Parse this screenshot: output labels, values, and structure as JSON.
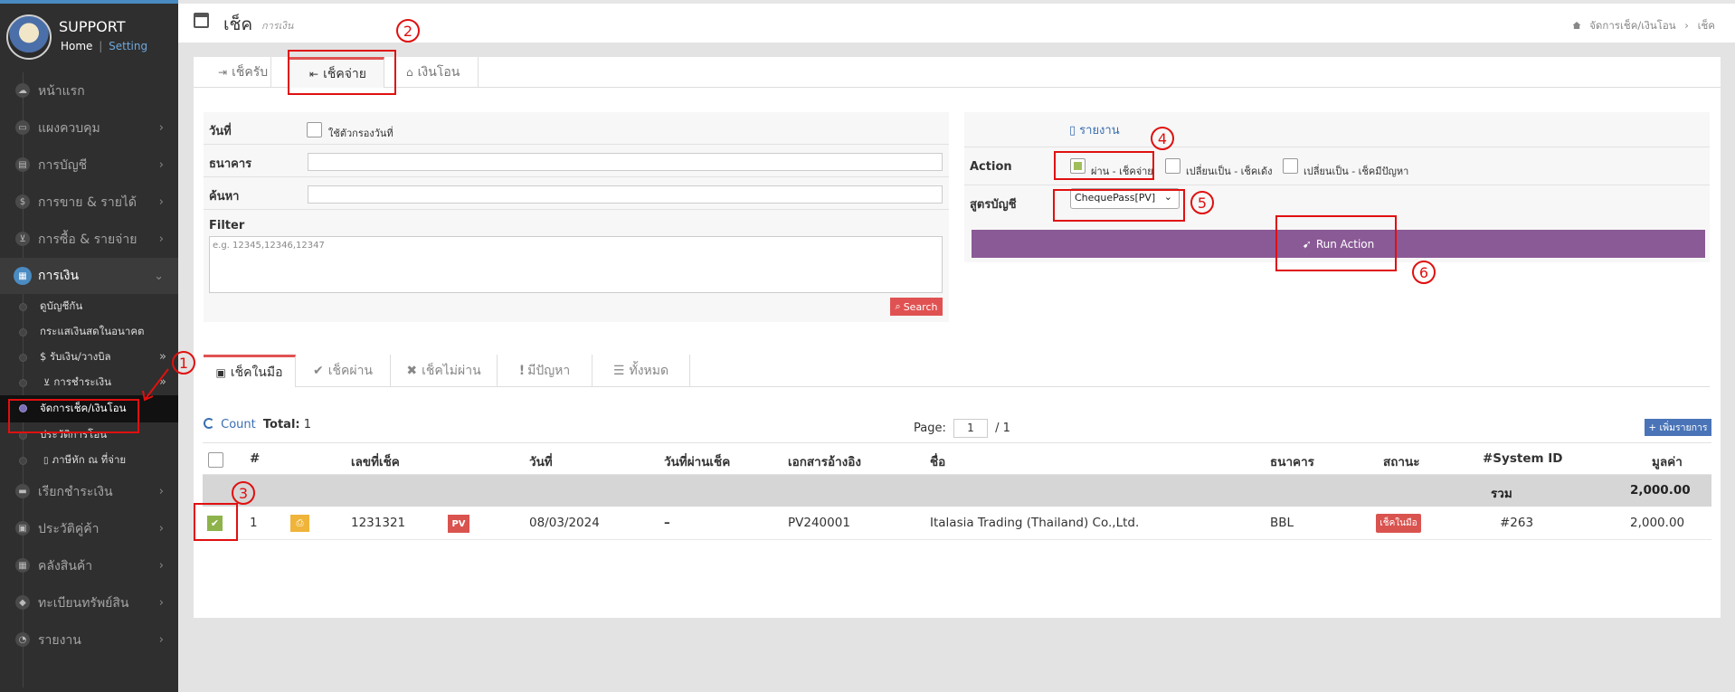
{
  "brand": {
    "title": "SUPPORT",
    "home": "Home",
    "separator": "|",
    "setting": "Setting"
  },
  "sidebar": {
    "items": [
      {
        "label": "หน้าแรก",
        "icon": "cloud-icon"
      },
      {
        "label": "แผงควบคุม",
        "icon": "monitor-icon"
      },
      {
        "label": "การบัญชี",
        "icon": "book-icon"
      },
      {
        "label": "การขาย & รายได้",
        "icon": "dollar-icon"
      },
      {
        "label": "การซื้อ & รายจ่าย",
        "icon": "cart-icon"
      },
      {
        "label": "การเงิน",
        "icon": "calendar-icon"
      }
    ],
    "sub_items": [
      {
        "label": "ดูบัญชีกัน"
      },
      {
        "label": "กระแสเงินสดในอนาคต"
      },
      {
        "label": "$ รับเงิน/วางบิล"
      },
      {
        "label": "การชำระเงิน"
      },
      {
        "label": "จัดการเช็ค/เงินโอน"
      },
      {
        "label": "ประวัติการโอน"
      },
      {
        "label": "ภาษีหัก ณ ที่จ่าย"
      }
    ],
    "items_after": [
      {
        "label": "เรียกชำระเงิน",
        "icon": "card-icon"
      },
      {
        "label": "ประวัติคู่ค้า",
        "icon": "contact-icon"
      },
      {
        "label": "คลังสินค้า",
        "icon": "boxes-icon"
      },
      {
        "label": "ทะเบียนทรัพย์สิน",
        "icon": "diamond-icon"
      },
      {
        "label": "รายงาน",
        "icon": "report-icon"
      }
    ]
  },
  "header": {
    "title": "เช็ค",
    "subtitle": "การเงิน",
    "breadcrumb_1": "จัดการเช็ค/เงินโอน",
    "breadcrumb_sep": "›",
    "breadcrumb_2": "เช็ค"
  },
  "tabs_top": [
    {
      "label": "เช็ครับ"
    },
    {
      "label": "เช็คจ่าย"
    },
    {
      "label": "เงินโอน"
    }
  ],
  "filters": {
    "date_label": "วันที่",
    "date_toggle_label": "ใช้ตัวกรองวันที่",
    "bank_label": "ธนาคาร",
    "bank_value": "",
    "search_label": "ค้นหา",
    "search_value": "",
    "filter_label": "Filter",
    "filter_placeholder": "e.g. 12345,12346,12347",
    "search_button": "Search"
  },
  "actions": {
    "report_link": "รายงาน",
    "action_label": "Action",
    "opt1": "ผ่าน - เช็คจ่าย",
    "opt2": "เปลี่ยนเป็น - เช็คเด้ง",
    "opt3": "เปลี่ยนเป็น - เช็คมีปัญหา",
    "formula_label": "สูตรบัญชี",
    "formula_value": "ChequePass[PV]",
    "run_button": "Run Action"
  },
  "tabs_status": [
    {
      "label": "เช็คในมือ"
    },
    {
      "label": "เช็คผ่าน"
    },
    {
      "label": "เช็คไม่ผ่าน"
    },
    {
      "label": "มีปัญหา"
    },
    {
      "label": "ทั้งหมด"
    }
  ],
  "list_info": {
    "count_label": "Count",
    "total_label": "Total:",
    "total_value": "1",
    "page_label": "Page:",
    "page_value": "1",
    "page_sep": "/",
    "page_total": "1",
    "add_button": "+ เพิ่มรายการ"
  },
  "table": {
    "headers": {
      "num": "#",
      "cheque_no": "เลขที่เช็ค",
      "date": "วันที่",
      "pass_date": "วันที่ผ่านเช็ค",
      "ref_doc": "เอกสารอ้างอิง",
      "name": "ชื่อ",
      "bank": "ธนาคาร",
      "status": "สถานะ",
      "system_id": "#System ID",
      "amount": "มูลค่า"
    },
    "summary": {
      "label": "รวม",
      "amount": "2,000.00"
    },
    "rows": [
      {
        "num": "1",
        "cheque_no": "1231321",
        "doc_badge": "PV",
        "date": "08/03/2024",
        "pass_date": "–",
        "ref_doc": "PV240001",
        "name": "Italasia Trading (Thailand) Co.,Ltd.",
        "bank": "BBL",
        "status": "เช็คในมือ",
        "system_id": "#263",
        "amount": "2,000.00"
      }
    ]
  },
  "annotations": [
    "1",
    "2",
    "3",
    "4",
    "5",
    "6"
  ],
  "colors": {
    "accent_red": "#e05252",
    "run_purple": "#8a5a96",
    "sidebar_bg": "#2f2f2f",
    "annotation_red": "#e01010",
    "link_blue": "#3a6fb0"
  }
}
